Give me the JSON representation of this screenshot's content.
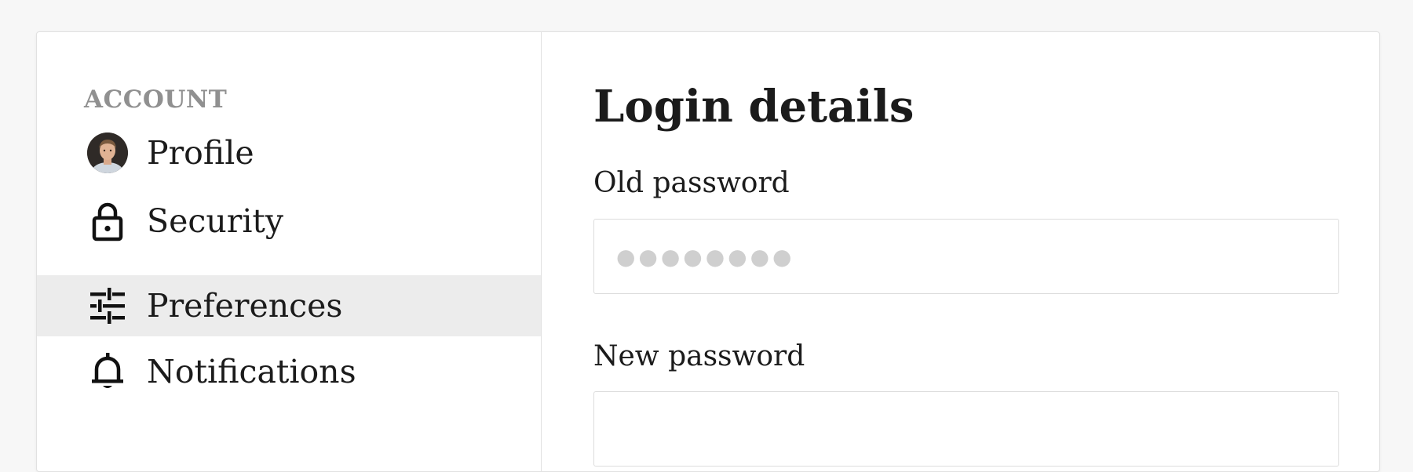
{
  "sidebar": {
    "heading": "ACCOUNT",
    "items": [
      {
        "label": "Profile",
        "icon": "avatar"
      },
      {
        "label": "Security",
        "icon": "lock-icon"
      },
      {
        "label": "Preferences",
        "icon": "sliders-icon",
        "active": true
      },
      {
        "label": "Notifications",
        "icon": "bell-icon"
      }
    ]
  },
  "main": {
    "title": "Login details",
    "old_password": {
      "label": "Old password",
      "value": "●●●●●●●●"
    },
    "new_password": {
      "label": "New password",
      "value": ""
    }
  },
  "colors": {
    "active_bg": "#ececec",
    "heading_gray": "#909090",
    "text": "#1b1b1b"
  }
}
